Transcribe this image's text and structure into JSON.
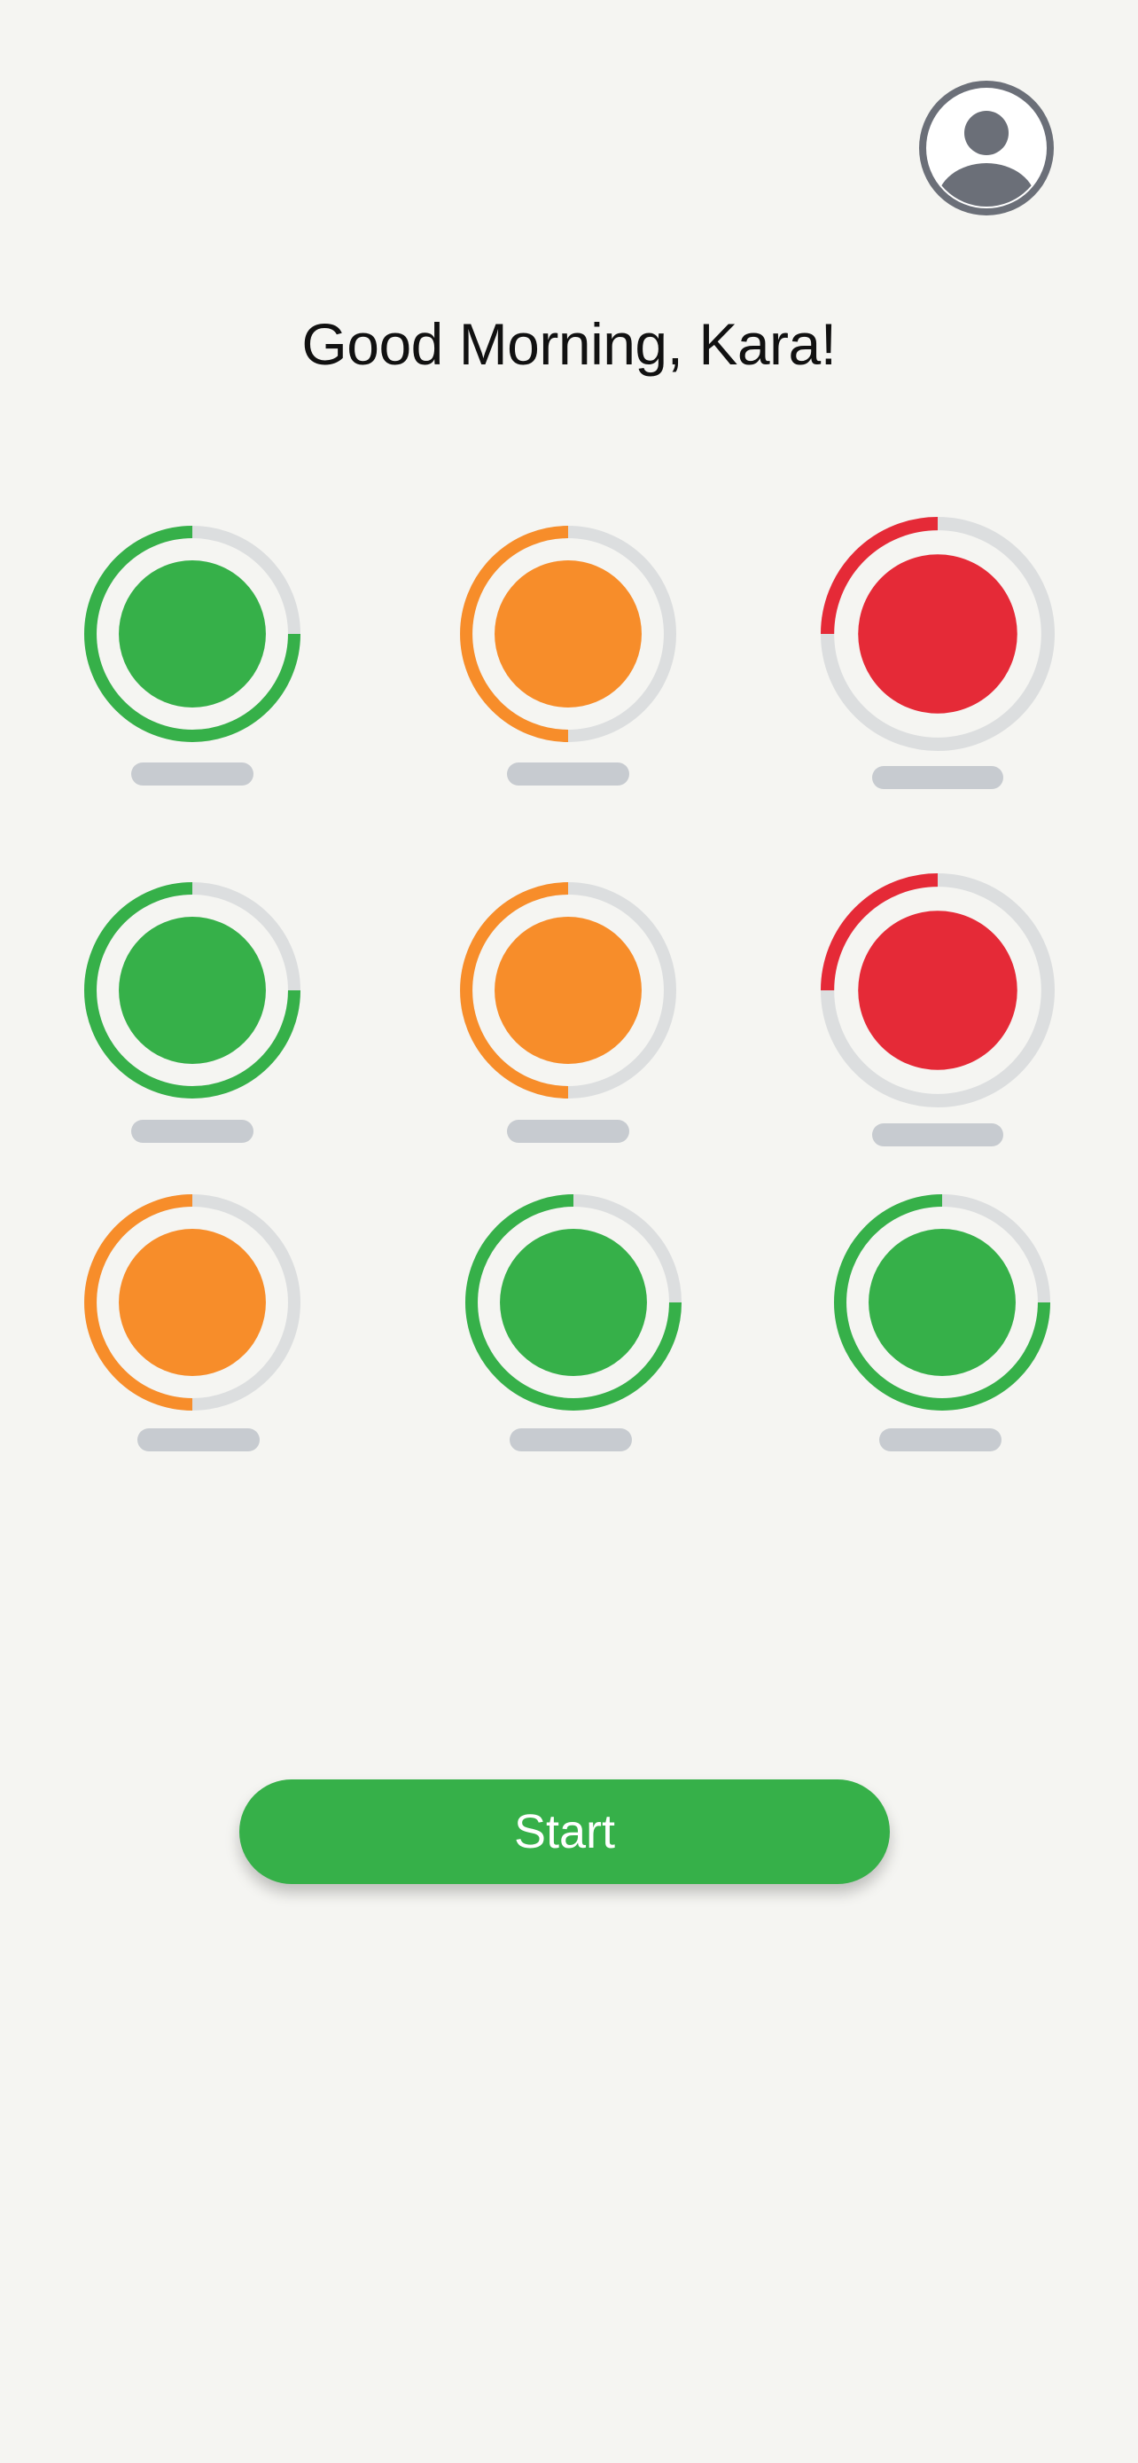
{
  "header": {
    "greeting": "Good Morning, Kara!",
    "avatar_icon": "user-circle-icon"
  },
  "colors": {
    "background": "#f5f5f2",
    "green": "#36b049",
    "orange": "#f78d2a",
    "red": "#e52a37",
    "track": "#dcdedf",
    "label_placeholder": "#c7cbd0",
    "avatar": "#6b6f78"
  },
  "rings": [
    {
      "status": "green",
      "progress": 0.75
    },
    {
      "status": "orange",
      "progress": 0.5
    },
    {
      "status": "red",
      "progress": 0.25
    },
    {
      "status": "green",
      "progress": 0.75
    },
    {
      "status": "orange",
      "progress": 0.5
    },
    {
      "status": "red",
      "progress": 0.25
    },
    {
      "status": "orange",
      "progress": 0.5
    },
    {
      "status": "green",
      "progress": 0.75
    },
    {
      "status": "green",
      "progress": 0.75
    }
  ],
  "actions": {
    "start_label": "Start"
  }
}
